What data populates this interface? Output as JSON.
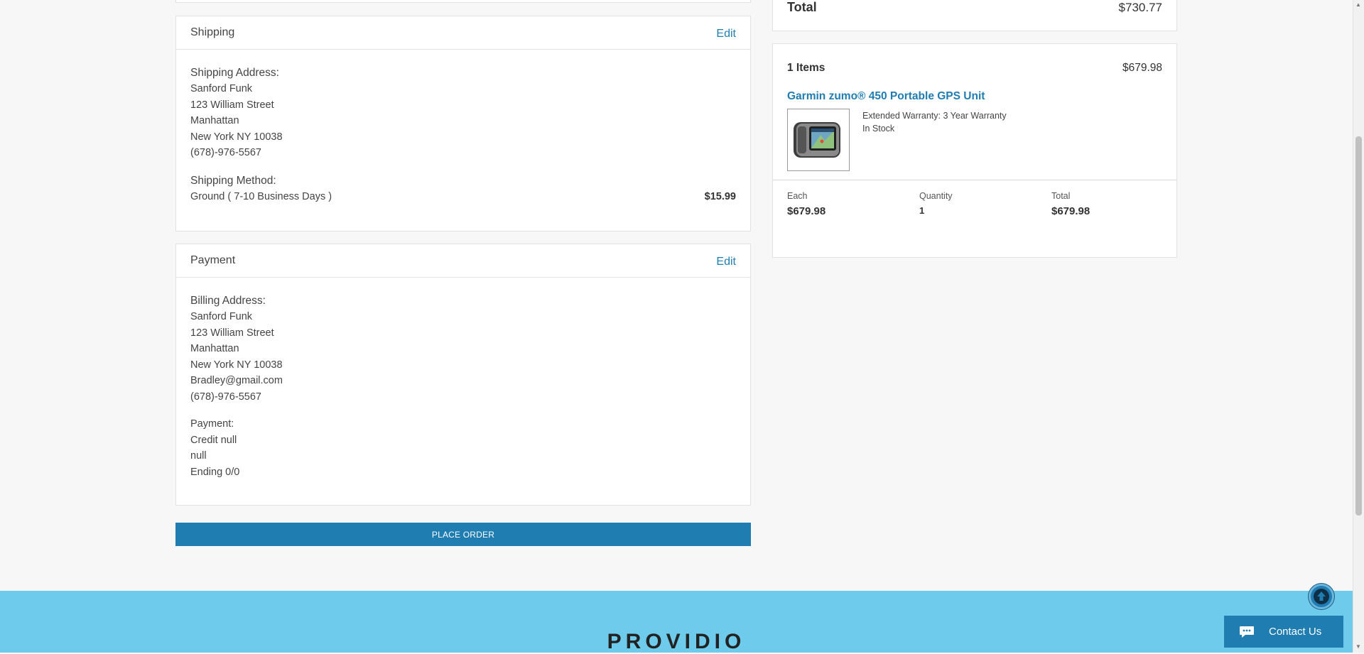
{
  "summary": {
    "total_label": "Total",
    "total_value": "$730.77"
  },
  "shipping": {
    "title": "Shipping",
    "edit_label": "Edit",
    "address_heading": "Shipping Address:",
    "address_lines": [
      "Sanford Funk",
      "123 William Street",
      "Manhattan",
      "New York NY 10038",
      "(678)-976-5567"
    ],
    "method_heading": "Shipping Method:",
    "method_name": "Ground ( 7-10 Business Days )",
    "method_price": "$15.99"
  },
  "payment": {
    "title": "Payment",
    "edit_label": "Edit",
    "billing_heading": "Billing Address:",
    "billing_lines": [
      "Sanford Funk",
      "123 William Street",
      "Manhattan",
      "New York NY 10038",
      "Bradley@gmail.com",
      "(678)-976-5567"
    ],
    "payment_heading": "Payment:",
    "payment_lines": [
      "Credit null",
      "null",
      "Ending 0/0"
    ]
  },
  "place_order_label": "PLACE ORDER",
  "cart": {
    "count_label": "1 Items",
    "subtotal": "$679.98",
    "product_name": "Garmin zumo® 450 Portable GPS Unit",
    "warranty": "Extended Warranty: 3 Year Warranty",
    "stock": "In Stock",
    "each_label": "Each",
    "each_value": "$679.98",
    "quantity_label": "Quantity",
    "quantity_value": "1",
    "total_label": "Total",
    "total_value": "$679.98"
  },
  "footer": {
    "brand": "PROVIDIO"
  },
  "contact_label": "Contact Us",
  "colors": {
    "accent": "#1f7db1",
    "footer": "#6ecbeb",
    "background": "#f7f7f7"
  },
  "icons": {
    "scroll_top": "arrow-up-icon",
    "contact": "chat-bubble-icon"
  }
}
